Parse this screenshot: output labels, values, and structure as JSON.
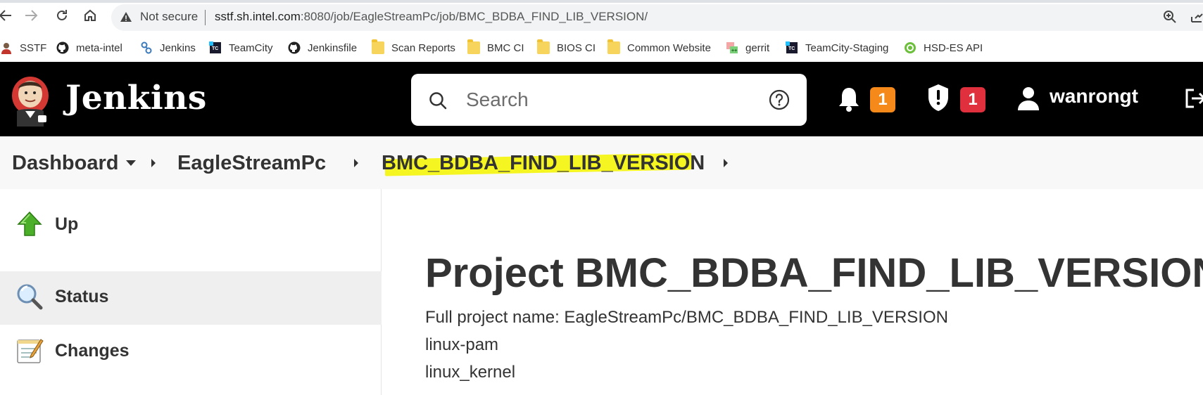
{
  "browser": {
    "security_label": "Not secure",
    "url_host": "sstf.sh.intel.com",
    "url_rest": ":8080/job/EagleStreamPc/job/BMC_BDBA_FIND_LIB_VERSION/",
    "bookmarks": [
      {
        "label": "SSTF",
        "icon": "person-icon"
      },
      {
        "label": "meta-intel",
        "icon": "github-icon"
      },
      {
        "label": "Jenkins",
        "icon": "jenkins-icon"
      },
      {
        "label": "TeamCity",
        "icon": "teamcity-icon"
      },
      {
        "label": "Jenkinsfile",
        "icon": "github-icon"
      },
      {
        "label": "Scan Reports",
        "icon": "folder-icon"
      },
      {
        "label": "BMC CI",
        "icon": "folder-icon"
      },
      {
        "label": "BIOS CI",
        "icon": "folder-icon"
      },
      {
        "label": "Common Website",
        "icon": "folder-icon"
      },
      {
        "label": "gerrit",
        "icon": "gerrit-icon"
      },
      {
        "label": "TeamCity-Staging",
        "icon": "teamcity-icon"
      },
      {
        "label": "HSD-ES API",
        "icon": "hsd-icon"
      }
    ]
  },
  "header": {
    "app_name": "Jenkins",
    "search_placeholder": "Search",
    "notifications_count": "1",
    "security_count": "1",
    "username": "wanrongt",
    "colors": {
      "bg": "#000000",
      "notify_badge": "#f58a1a",
      "security_badge": "#e0303d"
    }
  },
  "breadcrumb": {
    "items": [
      "Dashboard",
      "EagleStreamPc",
      "BMC_BDBA_FIND_LIB_VERSION"
    ],
    "highlight_color": "#f5f522"
  },
  "sidepanel": {
    "items": [
      {
        "label": "Up",
        "icon": "up-arrow-icon"
      },
      {
        "label": "Status",
        "icon": "magnifier-icon"
      },
      {
        "label": "Changes",
        "icon": "notepad-icon"
      }
    ]
  },
  "main": {
    "title": "Project BMC_BDBA_FIND_LIB_VERSION",
    "full_name_line": "Full project name: EagleStreamPc/BMC_BDBA_FIND_LIB_VERSION",
    "lines": [
      "linux-pam",
      "linux_kernel"
    ]
  }
}
